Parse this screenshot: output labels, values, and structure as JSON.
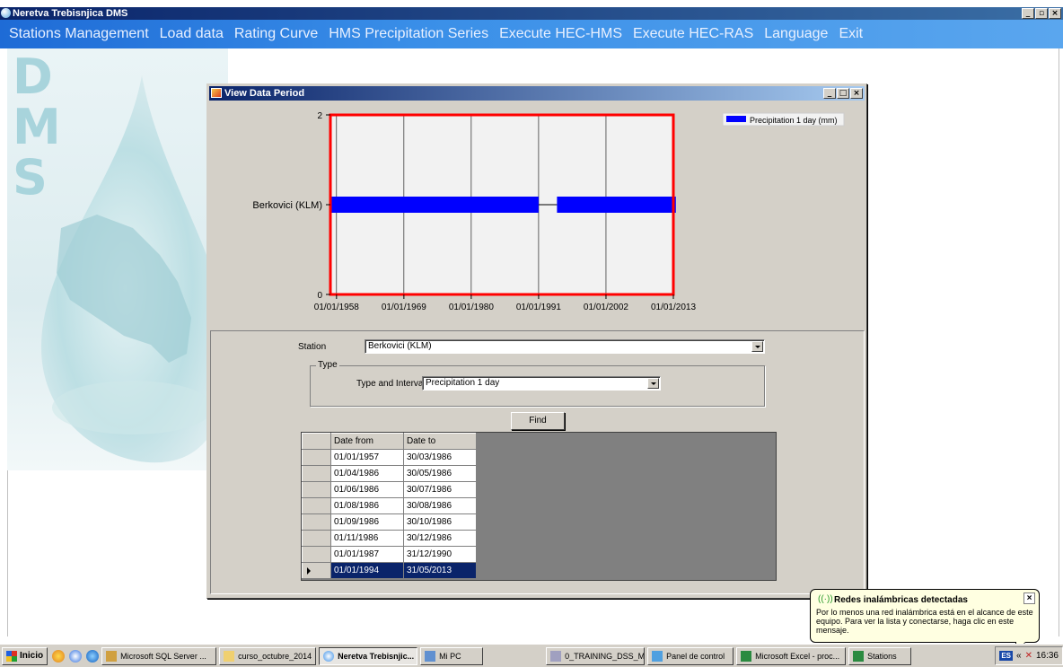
{
  "app": {
    "title": "Neretva Trebisnjica DMS"
  },
  "menu": [
    "Stations Management",
    "Load data",
    "Rating Curve",
    "HMS Precipitation Series",
    "Execute HEC-HMS",
    "Execute HEC-RAS",
    "Language",
    "Exit"
  ],
  "logo_letters": [
    "D",
    "M",
    "S"
  ],
  "child_window": {
    "title": "View Data Period"
  },
  "chart_data": {
    "type": "gantt",
    "y_tick_top": "2",
    "y_tick_bottom": "0",
    "category": "Berkovici (KLM)",
    "x_ticks": [
      "01/01/1958",
      "01/01/1969",
      "01/01/1980",
      "01/01/1991",
      "01/01/2002",
      "01/01/2013"
    ],
    "legend": "Precipitation 1 day (mm)",
    "bar_color": "#0000ff",
    "frame_color": "#ff0000",
    "xlim": [
      "01/01/1957",
      "01/01/2013"
    ],
    "ylim": [
      0,
      2
    ],
    "series": [
      {
        "name": "Precipitation 1 day (mm)",
        "from": "01/01/1957",
        "to": "31/12/1990"
      },
      {
        "name": "Precipitation 1 day (mm)",
        "from": "01/01/1994",
        "to": "31/05/2013"
      }
    ]
  },
  "form": {
    "station_label": "Station",
    "station_value": "Berkovici (KLM)",
    "type_group_label": "Type",
    "type_interval_label": "Type and Interval",
    "type_interval_value": "Precipitation 1 day",
    "find_label": "Find"
  },
  "grid": {
    "headers": [
      "Date from",
      "Date to"
    ],
    "rows": [
      [
        "01/01/1957",
        "30/03/1986"
      ],
      [
        "01/04/1986",
        "30/05/1986"
      ],
      [
        "01/06/1986",
        "30/07/1986"
      ],
      [
        "01/08/1986",
        "30/08/1986"
      ],
      [
        "01/09/1986",
        "30/10/1986"
      ],
      [
        "01/11/1986",
        "30/12/1986"
      ],
      [
        "01/01/1987",
        "31/12/1990"
      ],
      [
        "01/01/1994",
        "31/05/2013"
      ]
    ],
    "selected_row": 7
  },
  "balloon": {
    "title": "Redes inalámbricas detectadas",
    "text": "Por lo menos una red inalámbrica está en el alcance de este equipo. Para ver la lista y conectarse, haga clic en este mensaje."
  },
  "taskbar": {
    "start": "Inicio",
    "tasks": [
      {
        "label": "Microsoft SQL Server ...",
        "active": false
      },
      {
        "label": "curso_octubre_2014",
        "active": false
      },
      {
        "label": "Neretva Trebisnjic...",
        "active": true
      },
      {
        "label": "Mi PC",
        "active": false
      },
      {
        "label": "0_TRAINING_DSS_M...",
        "active": false
      },
      {
        "label": "Panel de control",
        "active": false
      },
      {
        "label": "Microsoft Excel - proc...",
        "active": false
      },
      {
        "label": "Stations",
        "active": false
      }
    ],
    "lang": "ES",
    "clock": "16:36"
  }
}
